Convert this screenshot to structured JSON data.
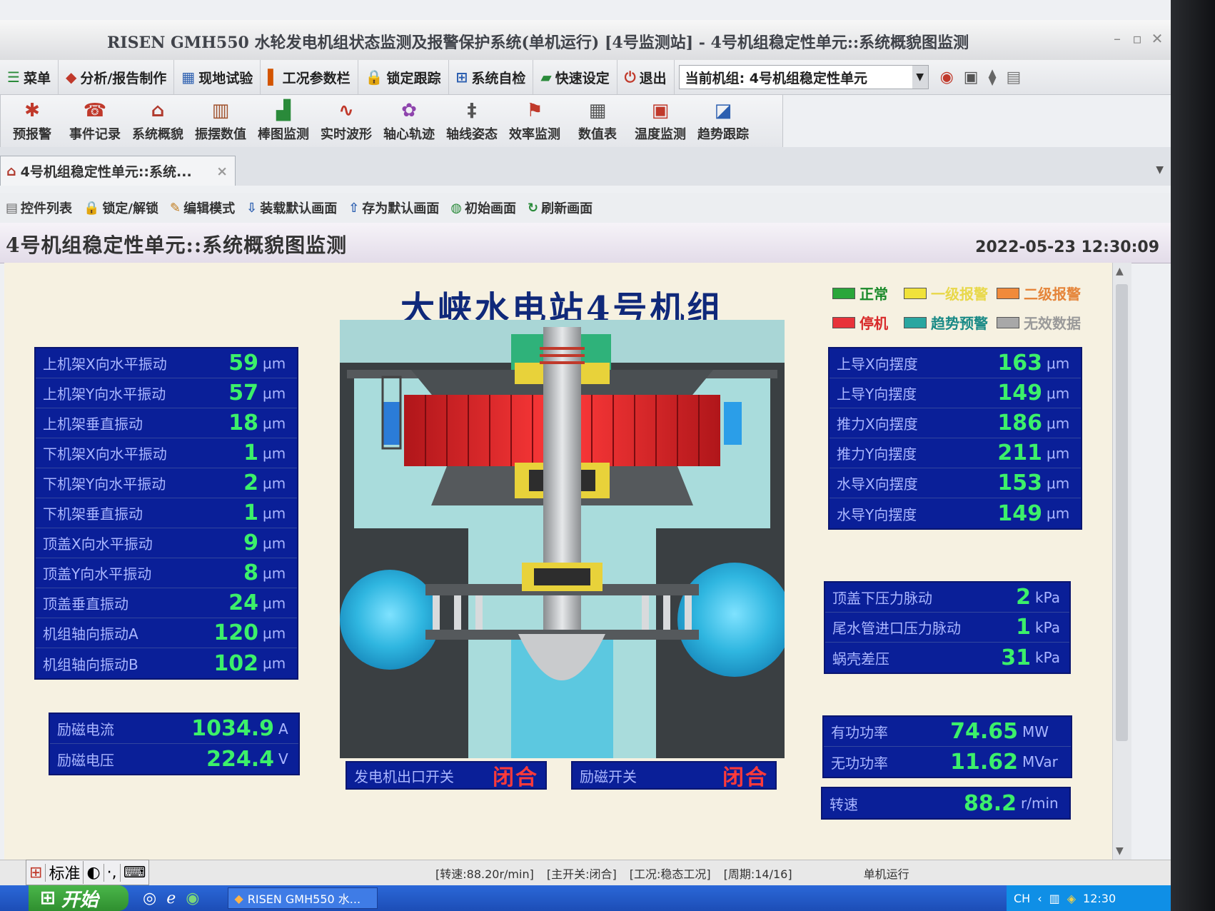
{
  "window": {
    "title": "RISEN GMH550 水轮发电机组状态监测及报警保护系统(单机运行) [4号监测站] - 4号机组稳定性单元::系统概貌图监测"
  },
  "menubar": {
    "items": [
      {
        "icon": "menu-icon",
        "label": "菜单"
      },
      {
        "icon": "analysis-icon",
        "label": "分析/报告制作"
      },
      {
        "icon": "field-test-icon",
        "label": "现地试验"
      },
      {
        "icon": "params-icon",
        "label": "工况参数栏"
      },
      {
        "icon": "lock-icon",
        "label": "锁定跟踪"
      },
      {
        "icon": "selfcheck-icon",
        "label": "系统自检"
      },
      {
        "icon": "quickset-icon",
        "label": "快速设定"
      },
      {
        "icon": "exit-icon",
        "label": "退出"
      }
    ],
    "unit_select_value": "当前机组: 4号机组稳定性单元"
  },
  "toolbar": {
    "buttons": [
      {
        "icon": "bug-alarm-icon",
        "label": "预报警"
      },
      {
        "icon": "phone-icon",
        "label": "事件记录"
      },
      {
        "icon": "home-icon",
        "label": "系统概貌"
      },
      {
        "icon": "book-icon",
        "label": "振摆数值"
      },
      {
        "icon": "bar-chart-icon",
        "label": "棒图监测"
      },
      {
        "icon": "waveform-icon",
        "label": "实时波形"
      },
      {
        "icon": "orbit-icon",
        "label": "轴心轨迹"
      },
      {
        "icon": "shaft-icon",
        "label": "轴线姿态"
      },
      {
        "icon": "flag-icon",
        "label": "效率监测"
      },
      {
        "icon": "table-icon",
        "label": "数值表"
      },
      {
        "icon": "monitor-icon",
        "label": "温度监测"
      },
      {
        "icon": "trend-icon",
        "label": "趋势跟踪"
      }
    ]
  },
  "tab": {
    "label": "4号机组稳定性单元::系统...",
    "close": "×"
  },
  "subtoolbar": {
    "items": [
      {
        "icon": "list-icon",
        "label": "控件列表"
      },
      {
        "icon": "lock-icon",
        "label": "锁定/解锁"
      },
      {
        "icon": "edit-icon",
        "label": "编辑模式"
      },
      {
        "icon": "load-icon",
        "label": "装载默认画面"
      },
      {
        "icon": "save-icon",
        "label": "存为默认画面"
      },
      {
        "icon": "globe-icon",
        "label": "初始画面"
      },
      {
        "icon": "refresh-icon",
        "label": "刷新画面"
      }
    ]
  },
  "page": {
    "title": "4号机组稳定性单元::系统概貌图监测",
    "datetime": "2022-05-23 12:30:09",
    "plant_title": "大峡水电站4号机组"
  },
  "legend": [
    {
      "label": "正常",
      "color": "#2aa63a",
      "text_color": "#1a8a2a"
    },
    {
      "label": "一级报警",
      "color": "#f0e23a",
      "text_color": "#e8d84a"
    },
    {
      "label": "二级报警",
      "color": "#f08a3a",
      "text_color": "#e5853a"
    },
    {
      "label": "停机",
      "color": "#e8333a",
      "text_color": "#d82a2a"
    },
    {
      "label": "趋势预警",
      "color": "#2aa6a0",
      "text_color": "#1a8a86"
    },
    {
      "label": "无效数据",
      "color": "#a8a8a8",
      "text_color": "#9a9a9a"
    }
  ],
  "vibration": [
    {
      "label": "上机架X向水平振动",
      "value": "59",
      "unit": "μm"
    },
    {
      "label": "上机架Y向水平振动",
      "value": "57",
      "unit": "μm"
    },
    {
      "label": "上机架垂直振动",
      "value": "18",
      "unit": "μm"
    },
    {
      "label": "下机架X向水平振动",
      "value": "1",
      "unit": "μm"
    },
    {
      "label": "下机架Y向水平振动",
      "value": "2",
      "unit": "μm"
    },
    {
      "label": "下机架垂直振动",
      "value": "1",
      "unit": "μm"
    },
    {
      "label": "顶盖X向水平振动",
      "value": "9",
      "unit": "μm"
    },
    {
      "label": "顶盖Y向水平振动",
      "value": "8",
      "unit": "μm"
    },
    {
      "label": "顶盖垂直振动",
      "value": "24",
      "unit": "μm"
    },
    {
      "label": "机组轴向振动A",
      "value": "120",
      "unit": "μm"
    },
    {
      "label": "机组轴向振动B",
      "value": "102",
      "unit": "μm"
    }
  ],
  "excitation": [
    {
      "label": "励磁电流",
      "value": "1034.9",
      "unit": "A"
    },
    {
      "label": "励磁电压",
      "value": "224.4",
      "unit": "V"
    }
  ],
  "swing": [
    {
      "label": "上导X向摆度",
      "value": "163",
      "unit": "μm"
    },
    {
      "label": "上导Y向摆度",
      "value": "149",
      "unit": "μm"
    },
    {
      "label": "推力X向摆度",
      "value": "186",
      "unit": "μm"
    },
    {
      "label": "推力Y向摆度",
      "value": "211",
      "unit": "μm"
    },
    {
      "label": "水导X向摆度",
      "value": "153",
      "unit": "μm"
    },
    {
      "label": "水导Y向摆度",
      "value": "149",
      "unit": "μm"
    }
  ],
  "pressure": [
    {
      "label": "顶盖下压力脉动",
      "value": "2",
      "unit": "kPa"
    },
    {
      "label": "尾水管进口压力脉动",
      "value": "1",
      "unit": "kPa"
    },
    {
      "label": "蜗壳差压",
      "value": "31",
      "unit": "kPa"
    }
  ],
  "power": [
    {
      "label": "有功功率",
      "value": "74.65",
      "unit": "MW"
    },
    {
      "label": "无功功率",
      "value": "11.62",
      "unit": "MVar"
    }
  ],
  "speed": {
    "label": "转速",
    "value": "88.2",
    "unit": "r/min"
  },
  "switches": {
    "gen_outlet": {
      "label": "发电机出口开关",
      "state": "闭合"
    },
    "excitation": {
      "label": "励磁开关",
      "state": "闭合"
    }
  },
  "colors": {
    "panel_bg": "#0a1f98",
    "value_green": "#3cf06a",
    "state_red": "#ff3a3a",
    "title_blue": "#10297a"
  },
  "statusbar": {
    "speed": "[转速:88.20r/min]",
    "main_switch": "[主开关:闭合]",
    "condition": "[工况:稳态工况]",
    "cycle": "[周期:14/16]",
    "mode": "单机运行"
  },
  "ime": {
    "mode": "标准"
  },
  "taskbar": {
    "start": "开始",
    "task": "RISEN GMH550 水...",
    "lang": "CH",
    "clock": "12:30"
  }
}
